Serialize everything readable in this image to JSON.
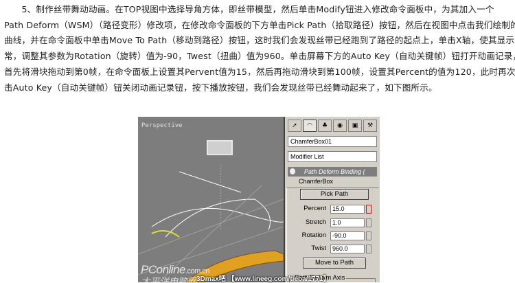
{
  "article": {
    "lines": [
      "　　5、制作丝带舞动动画。在TOP视图中选择导角方体，即丝带模型，然后单击Modify钮进入修改命令面板中，为其加入一个",
      "Path Deform（WSM）（路径变形）修改项，在修改命令面板的下方单击Pick Path（拾取路径）按钮，然后在视图中点击我们绘制的",
      "曲线，并在命令面板中单击Move To Path（移动到路径）按钮，这时我们会发现丝带已经跑到了路径的起点上，单击X轴，使其显示正",
      "常，调整其参数为Rotation（旋转）值为-90，Twest（扭曲）值为960。单击屏幕下方的Auto Key（自动关键帧）钮打开动画记录，",
      "首先将滑块拖动到第0帧，在命令面板上设置其Pervent值为15，然后再拖动滑块到第100帧，设置其Percent的值为120，此时再次单",
      "击Auto Key（自动关键帧）钮关闭动画记录钮，按下播放按钮，我们会发现丝带已经舞动起来了，如下图所示。"
    ]
  },
  "viewport": {
    "label": "Perspective",
    "watermark": "PConline",
    "watermark_suffix": ".com.cn",
    "watermark_cn": "太平洋电脑网"
  },
  "command_panel": {
    "object_name": "ChamferBox01",
    "modifier_list": "Modifier List",
    "stack_top": "Path Deform Binding (",
    "stack_base": "ChamferBox",
    "pick_path": "Pick Path",
    "params": [
      {
        "label": "Percent",
        "value": "15.0"
      },
      {
        "label": "Stretch",
        "value": "1.0"
      },
      {
        "label": "Rotation",
        "value": "-90.0"
      },
      {
        "label": "Twist",
        "value": "960.0"
      }
    ],
    "move_to_path": "Move to Path",
    "group_title": "Path Deform Axis"
  },
  "credit": "3Dmax吧 【www.lineeg.com/tieba/1771】",
  "colors": {
    "viewport_bg": "#7d7d7d",
    "ribbon": "#e0a020",
    "panel_bg": "#d4d0c8",
    "highlight": "#c02020"
  }
}
